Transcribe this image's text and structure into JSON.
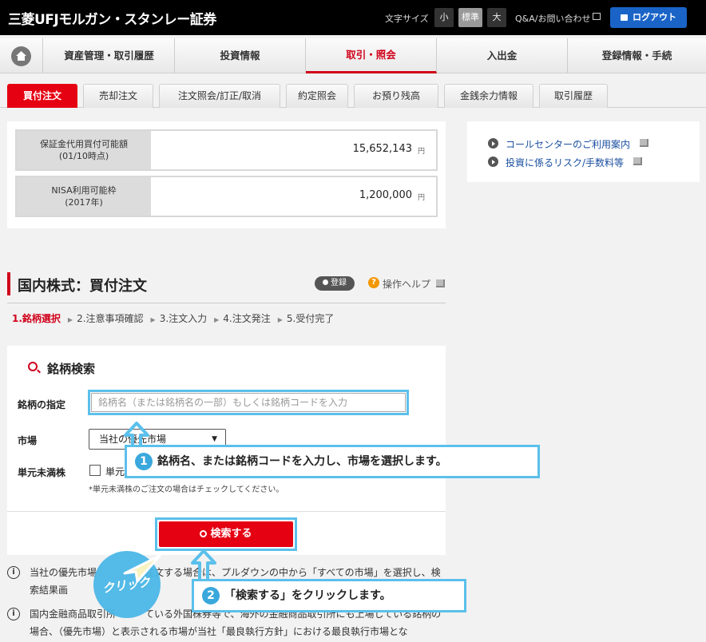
{
  "header": {
    "logo": "三菱UFJモルガン・スタンレー証券",
    "font_size_label": "文字サイズ",
    "font_sizes": [
      "小",
      "標準",
      "大"
    ],
    "qa": "Q&A/お問い合わせ",
    "logout": "ログアウト"
  },
  "nav": [
    "資産管理・取引履歴",
    "投資情報",
    "取引・照会",
    "入出金",
    "登録情報・手続"
  ],
  "subtabs": [
    "買付注文",
    "売却注文",
    "注文照会/訂正/取消",
    "約定照会",
    "お預り残高",
    "金銭余力情報",
    "取引履歴"
  ],
  "balances": [
    {
      "label1": "保証金代用買付可能額",
      "label2": "(01/10時点)",
      "value": "15,652,143",
      "unit": "円"
    },
    {
      "label1": "NISA利用可能枠",
      "label2": "(2017年)",
      "value": "1,200,000",
      "unit": "円"
    }
  ],
  "links": [
    "コールセンターのご利用案内",
    "投資に係るリスク/手数料等"
  ],
  "page": {
    "title": "国内株式：買付注文",
    "register": "登録",
    "help": "操作ヘルプ",
    "steps": [
      "1.銘柄選択",
      "2.注意事項確認",
      "3.注文入力",
      "4.注文発注",
      "5.受付完了"
    ]
  },
  "search": {
    "heading": "銘柄検索",
    "name_label": "銘柄の指定",
    "placeholder": "銘柄名（または銘柄名の一部）もしくは銘柄コードを入力",
    "market_label": "市場",
    "market_value": "当社の優先市場",
    "odd_label": "単元未満株",
    "odd_check": "単元",
    "odd_note": "*単元未満株のご注文の場合はチェックしてください。",
    "button": "検索する"
  },
  "notices": [
    "当社の優先市場　　　　　注文する場合は、プルダウンの中から「すべての市場」を選択し、検索結果画",
    "国内金融商品取引所　　　ている外国株券等で、海外の金融商品取引所にも上場している銘柄の場合、（優先市場）と表示される市場が当社「最良執行方針」における最良執行市場とな"
  ],
  "callouts": [
    {
      "num": "1",
      "text": "銘柄名、または銘柄コードを入力し、市場を選択します。"
    },
    {
      "num": "2",
      "text": "「検索する」をクリックします。"
    }
  ],
  "click_label": "クリック",
  "colors": {
    "accent": "#e50012",
    "callout": "#5bc0eb",
    "link": "#1a4fa0"
  }
}
